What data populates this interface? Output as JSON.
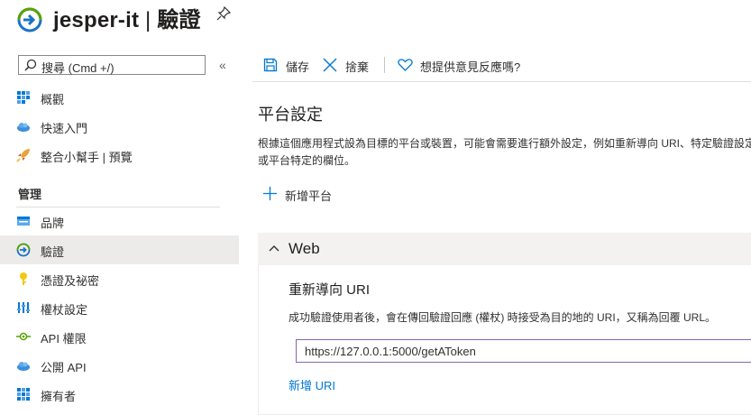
{
  "header": {
    "app_name": "jesper-it",
    "separator": "|",
    "page": "驗證",
    "icons": {
      "logo": "azure-auth-logo",
      "pin": "pin-icon"
    }
  },
  "sidebar": {
    "search_placeholder": "搜尋 (Cmd +/)",
    "collapse_glyph": "«",
    "items": [
      {
        "label": "概觀",
        "icon": "overview-grid-icon",
        "active": false
      },
      {
        "label": "快速入門",
        "icon": "cloud-icon",
        "active": false
      },
      {
        "label": "整合小幫手 | 預覽",
        "icon": "rocket-icon",
        "active": false
      }
    ],
    "section_title": "管理",
    "manage_items": [
      {
        "label": "品牌",
        "icon": "branding-icon",
        "active": false
      },
      {
        "label": "驗證",
        "icon": "authentication-icon",
        "active": true
      },
      {
        "label": "憑證及祕密",
        "icon": "key-icon",
        "active": false
      },
      {
        "label": "權杖設定",
        "icon": "token-bars-icon",
        "active": false
      },
      {
        "label": "API 權限",
        "icon": "api-permissions-icon",
        "active": false
      },
      {
        "label": "公開 API",
        "icon": "cloud-api-icon",
        "active": false
      },
      {
        "label": "擁有者",
        "icon": "owners-grid-icon",
        "active": false
      }
    ]
  },
  "toolbar": {
    "save": "儲存",
    "discard": "捨棄",
    "feedback": "想提供意見反應嗎?"
  },
  "main": {
    "platform_heading": "平台設定",
    "platform_desc": "根據這個應用程式設為目標的平台或裝置，可能會需要進行額外設定，例如重新導向 URI、特定驗證設定或平台特定的欄位。",
    "add_platform": "新增平台",
    "web": {
      "title": "Web",
      "redirect_title": "重新導向 URI",
      "redirect_desc": "成功驗證使用者後，會在傳回驗證回應 (權杖) 時接受為目的地的 URI，又稱為回覆 URL。",
      "uri_value": "https://127.0.0.1:5000/getAToken",
      "add_uri": "新增 URI"
    }
  },
  "colors": {
    "accent": "#0078d4",
    "active_bg": "#edebe9",
    "focus_border": "#8764b8"
  }
}
